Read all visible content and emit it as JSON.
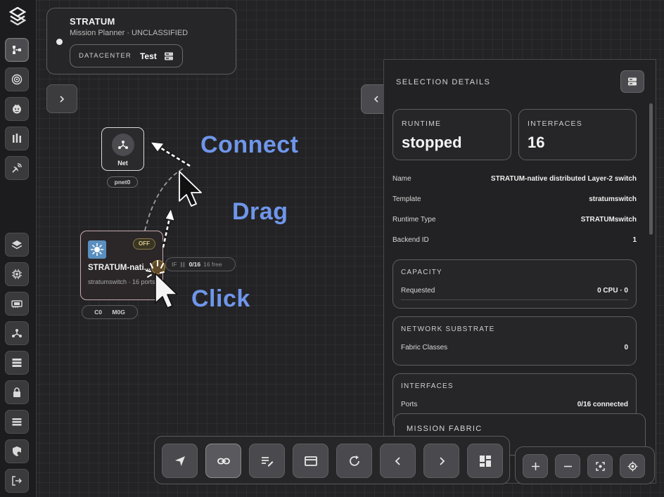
{
  "header": {
    "title": "STRATUM",
    "subtitle": "Mission Planner · UNCLASSIFIED",
    "datacenter_label": "DATACENTER",
    "datacenter_value": "Test"
  },
  "rail": {
    "items": [
      "logo-icon",
      "topology-icon",
      "target-icon",
      "face-icon",
      "rack-icon",
      "satellite-icon",
      "layers-icon",
      "chip-icon",
      "gpu-icon",
      "network-icon",
      "server-list-icon",
      "lock-icon",
      "storage-icon",
      "shield-icon",
      "logout-icon"
    ],
    "active": "topology-icon"
  },
  "canvas": {
    "net_node": {
      "label": "Net",
      "tag": "pnet0"
    },
    "stratum_node": {
      "title": "STRATUM-nati...",
      "status": "OFF",
      "subtitle": "stratumswitch · 16 ports",
      "interface_tag": {
        "prefix": "IF",
        "value": "0/16",
        "free": "16 free"
      },
      "tags": [
        "C0",
        "M0G"
      ]
    }
  },
  "annotations": {
    "connect": "Connect",
    "drag": "Drag",
    "click": "Click"
  },
  "panel": {
    "title": "SELECTION DETAILS",
    "runtime": {
      "label": "RUNTIME",
      "value": "stopped"
    },
    "interfaces": {
      "label": "INTERFACES",
      "value": "16"
    },
    "details": [
      {
        "key": "Name",
        "value": "STRATUM-native distributed Layer-2 switch"
      },
      {
        "key": "Template",
        "value": "stratumswitch"
      },
      {
        "key": "Runtime Type",
        "value": "STRATUMswitch"
      },
      {
        "key": "Backend ID",
        "value": "1"
      }
    ],
    "capacity": {
      "title": "CAPACITY",
      "key": "Requested",
      "value": "0 CPU · 0"
    },
    "network": {
      "title": "NETWORK SUBSTRATE",
      "key": "Fabric Classes",
      "value": "0"
    },
    "interfaces_section": {
      "title": "INTERFACES",
      "key": "Ports",
      "value": "0/16 connected"
    },
    "mission_fabric": "MISSION FABRIC"
  },
  "toolbar": {
    "buttons": [
      "navigate-icon",
      "link-icon",
      "edit-list-icon",
      "window-icon",
      "refresh-icon",
      "chevron-left-icon",
      "chevron-right-icon",
      "dashboard-icon"
    ],
    "active": "link-icon"
  },
  "zoom": {
    "buttons": [
      "zoom-in-icon",
      "zoom-out-icon",
      "fit-view-icon",
      "locate-icon"
    ]
  },
  "colors": {
    "annotation": "#6f96ea",
    "background": "#232325",
    "node_border_selected": "#c9a9b0"
  }
}
